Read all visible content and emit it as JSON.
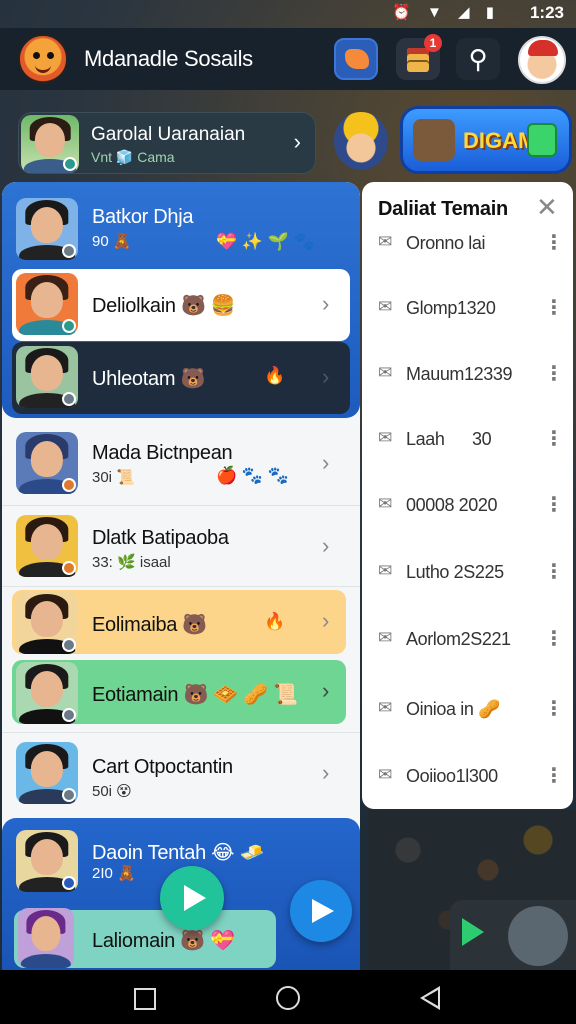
{
  "status": {
    "time": "1:23",
    "icons": "⏰ ▼ ◢ ▮"
  },
  "header": {
    "title": "Mdanadle Sosails",
    "notifications_badge": "1",
    "pin_icon": "pin-icon"
  },
  "profile": {
    "name": "Garolal Uaranaian",
    "sub": "Vnt 🧊 Cama",
    "chevron": "›"
  },
  "game_button": {
    "label": "DIGAMI"
  },
  "chats": [
    {
      "name": "Batkor Dhja",
      "sub": "90 🧸",
      "emoji": "💝 ✨ 🌱 🐾"
    },
    {
      "name": "Deliolkain 🐻 🍔",
      "sub": "",
      "emoji": ""
    },
    {
      "name": "Uhleotam 🐻",
      "sub": "",
      "emoji": "🔥"
    },
    {
      "name": "Mada Bictnpean",
      "sub": "30i 📜",
      "emoji": "🍎 🐾 🐾"
    },
    {
      "name": "Dlatk Batipaoba",
      "sub": "33: 🌿 isaal",
      "emoji": ""
    },
    {
      "name": "Eolimaiba 🐻",
      "sub": "",
      "emoji": "🔥"
    },
    {
      "name": "Eotiamain 🐻 🧇 🥜 📜",
      "sub": "",
      "emoji": ""
    },
    {
      "name": "Cart Otpoctantin",
      "sub": "50i 😵",
      "emoji": ""
    },
    {
      "name": "Daoin Tentah 😂 🧈",
      "sub": "2I0 🧸",
      "emoji": ""
    },
    {
      "name": "Laliomain 🐻 💝",
      "sub": "",
      "emoji": ""
    }
  ],
  "friends_panel": {
    "title": "Daliiat Temain",
    "close": "✕",
    "items": [
      "Oronno lai",
      "Glomp1320",
      "Mauum12339",
      "Laah      30",
      "00008 2020",
      "Lutho 2S225",
      "Aorlom2S221",
      "Oinioa in 🥜",
      "Ooiioo1l300"
    ]
  },
  "colors": {
    "accent_blue": "#2d73d4",
    "accent_green": "#21c39a",
    "card_yellow": "#fcd58a",
    "card_green": "#6ed592"
  }
}
